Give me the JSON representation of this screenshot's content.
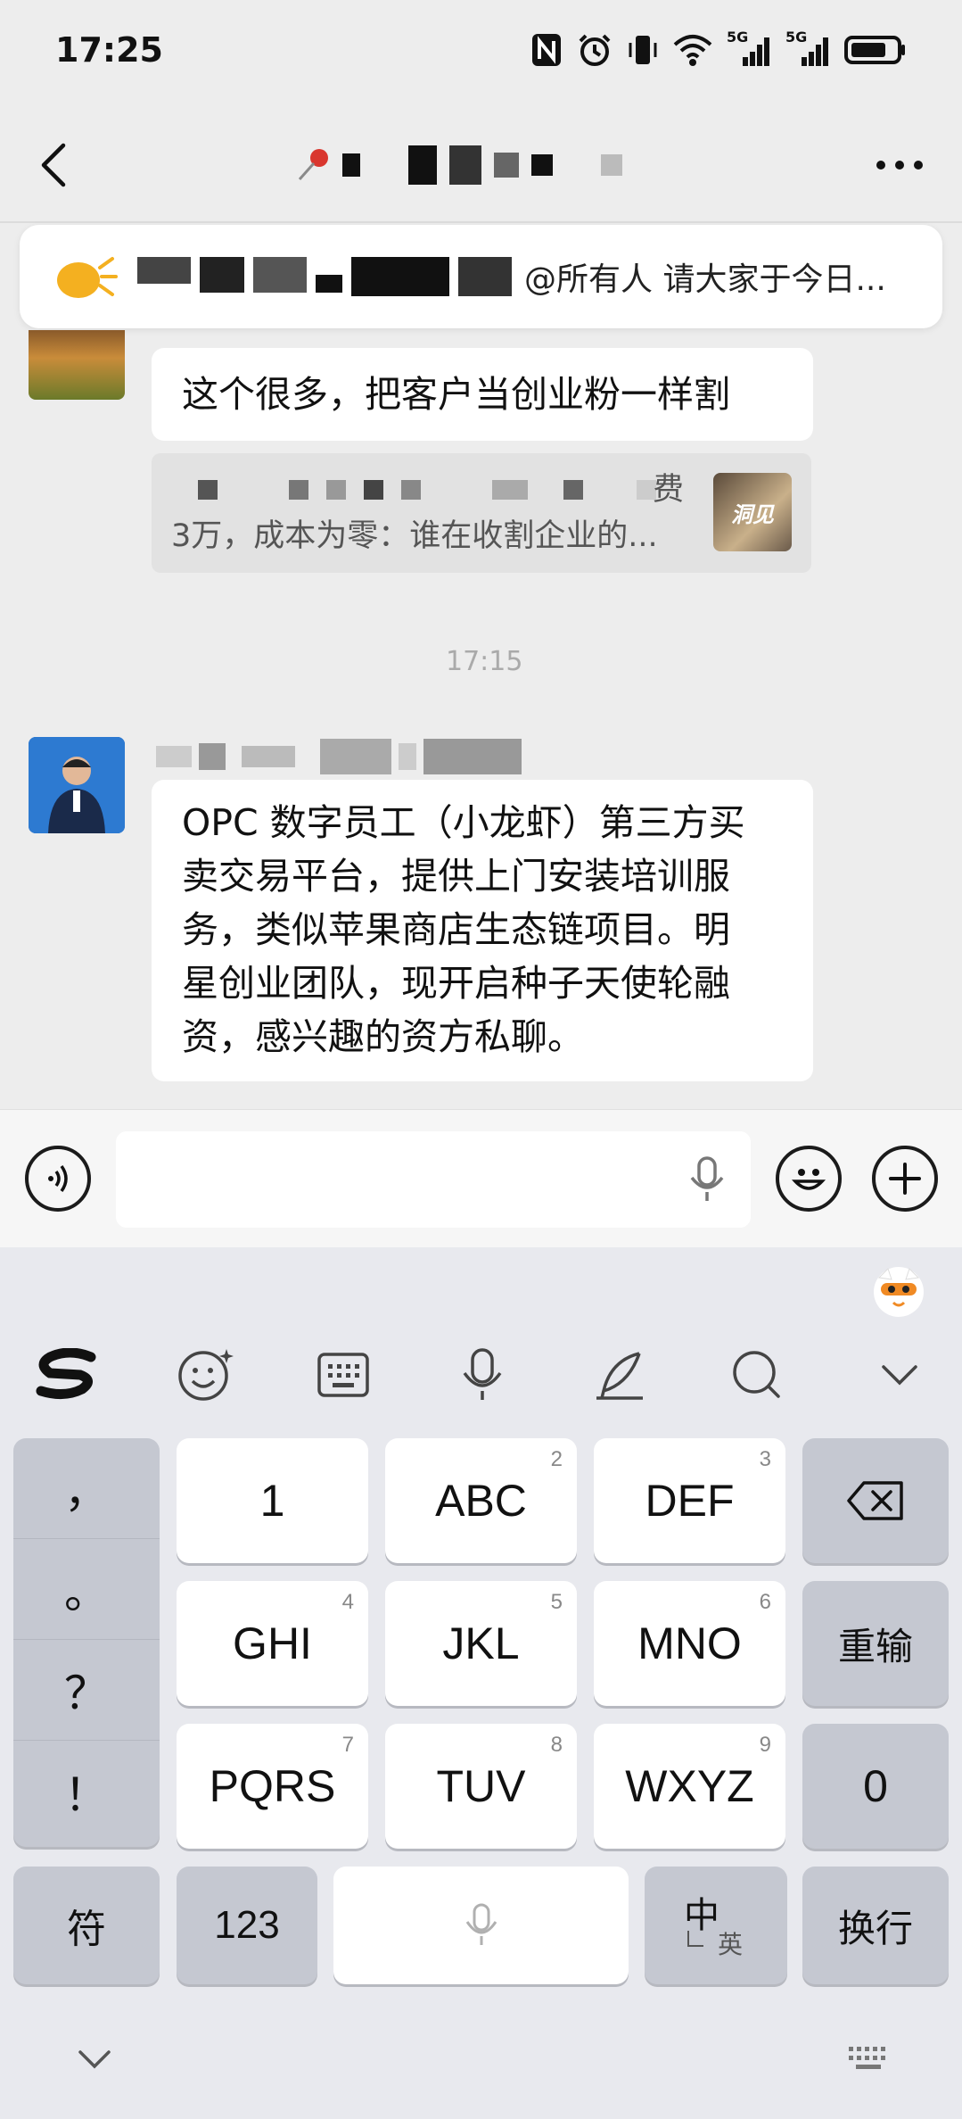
{
  "status_bar": {
    "time": "17:25",
    "network_1": "5G",
    "network_2": "5G"
  },
  "announcement": {
    "text": "@所有人 请大家于今日..."
  },
  "messages": [
    {
      "text": "这个很多，把客户当创业粉一样割",
      "quote_line1": "费",
      "quote_line2": "3万，成本为零：谁在收割企业的...",
      "quote_thumb": "洞见"
    },
    {
      "text_lines": [
        "OPC 数字员工（小龙虾）第三方买",
        "卖交易平台，提供上门安装培训服",
        "务，类似苹果商店生态链项目。明",
        "星创业团队，现开启种子天使轮融",
        "资，感兴趣的资方私聊。"
      ]
    }
  ],
  "timestamp": "17:15",
  "keyboard": {
    "punct": [
      "，",
      "。",
      "？",
      "！"
    ],
    "rows": [
      [
        {
          "label": "1",
          "sub": ""
        },
        {
          "label": "ABC",
          "sub": "2"
        },
        {
          "label": "DEF",
          "sub": "3"
        }
      ],
      [
        {
          "label": "GHI",
          "sub": "4"
        },
        {
          "label": "JKL",
          "sub": "5"
        },
        {
          "label": "MNO",
          "sub": "6"
        }
      ],
      [
        {
          "label": "PQRS",
          "sub": "7"
        },
        {
          "label": "TUV",
          "sub": "8"
        },
        {
          "label": "WXYZ",
          "sub": "9"
        }
      ]
    ],
    "reset": "重输",
    "zero": "0",
    "symbols": "符",
    "numbers": "123",
    "lang_main": "中",
    "lang_sub": "英",
    "enter": "换行"
  }
}
